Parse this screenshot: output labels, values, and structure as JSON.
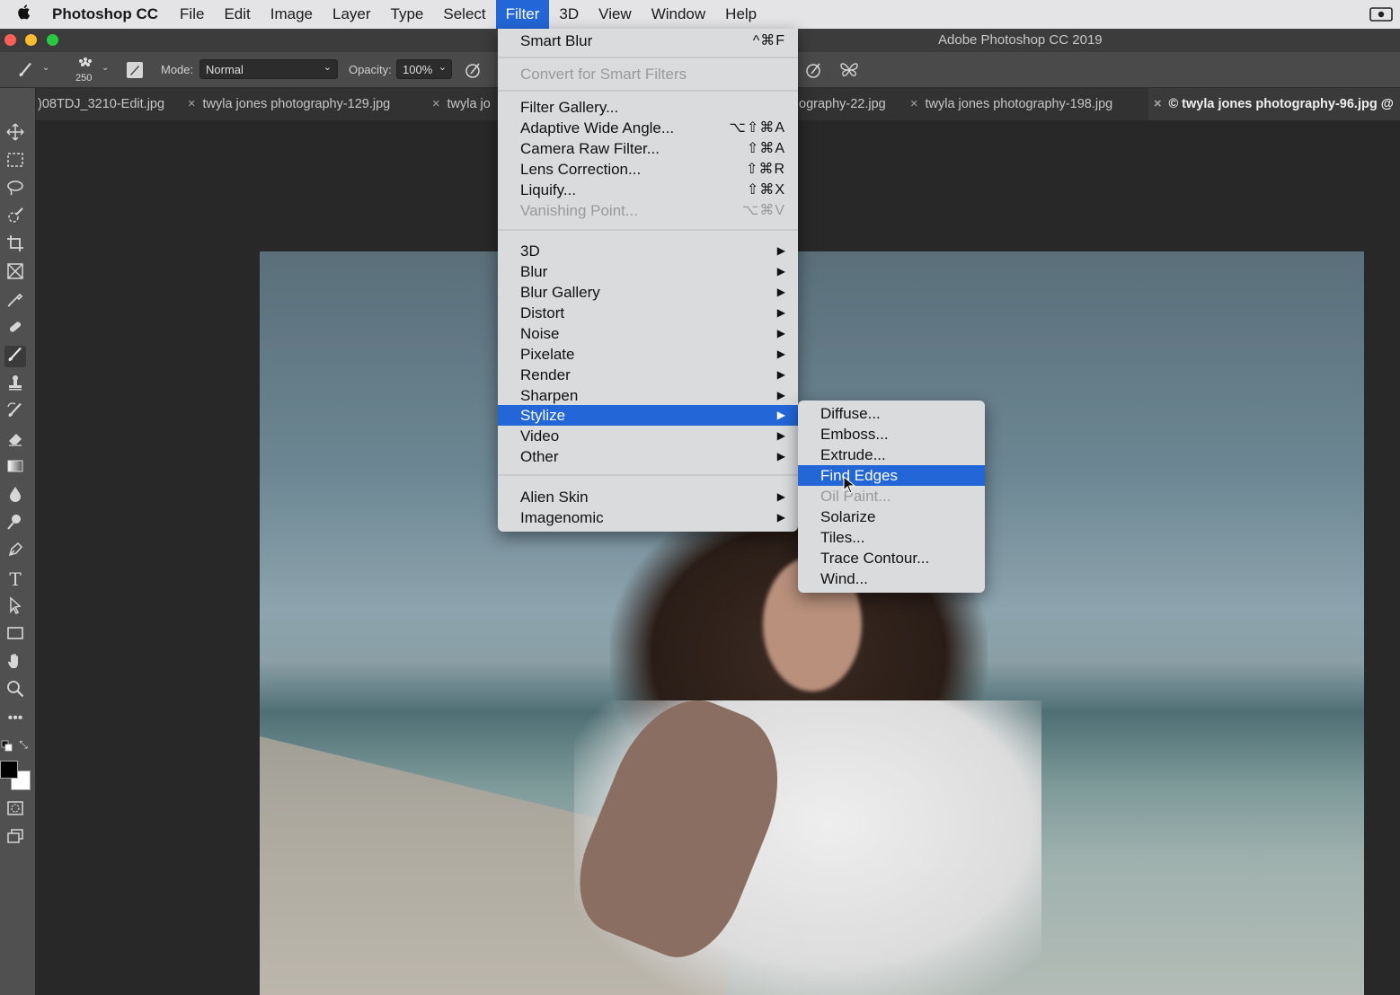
{
  "menubar": {
    "apple_icon": "apple-logo",
    "app_name": "Photoshop CC",
    "items": [
      "File",
      "Edit",
      "Image",
      "Layer",
      "Type",
      "Select",
      "Filter",
      "3D",
      "View",
      "Window",
      "Help"
    ],
    "active_item": "Filter"
  },
  "window": {
    "title": "Adobe Photoshop CC 2019",
    "traffic_lights": {
      "close": "#fe5f57",
      "minimize": "#febc2e",
      "zoom": "#28c840"
    }
  },
  "options_bar": {
    "brush_size": "250",
    "mode_label": "Mode:",
    "mode_value": "Normal",
    "opacity_label": "Opacity:",
    "opacity_value": "100%"
  },
  "tabs": [
    {
      "label": ")08TDJ_3210-Edit.jpg",
      "active": false
    },
    {
      "label": "twyla jones photography-129.jpg",
      "active": false
    },
    {
      "label": "twyla jo",
      "active": false
    },
    {
      "label": "ography-22.jpg",
      "active": false
    },
    {
      "label": "twyla jones photography-198.jpg",
      "active": false
    },
    {
      "label": "© twyla jones photography-96.jpg @",
      "active": true
    }
  ],
  "tab_close_glyph": "×",
  "filter_menu": {
    "items": [
      {
        "label": "Smart Blur",
        "shortcut": "^⌘F",
        "disabled": false
      },
      {
        "label": "Convert for Smart Filters",
        "shortcut": "",
        "disabled": true
      },
      {
        "label": "Filter Gallery...",
        "shortcut": "",
        "disabled": false
      },
      {
        "label": "Adaptive Wide Angle...",
        "shortcut": "⌥⇧⌘A",
        "disabled": false
      },
      {
        "label": "Camera Raw Filter...",
        "shortcut": "⇧⌘A",
        "disabled": false
      },
      {
        "label": "Lens Correction...",
        "shortcut": "⇧⌘R",
        "disabled": false
      },
      {
        "label": "Liquify...",
        "shortcut": "⇧⌘X",
        "disabled": false
      },
      {
        "label": "Vanishing Point...",
        "shortcut": "⌥⌘V",
        "disabled": true
      },
      {
        "label": "3D",
        "submenu": true
      },
      {
        "label": "Blur",
        "submenu": true
      },
      {
        "label": "Blur Gallery",
        "submenu": true
      },
      {
        "label": "Distort",
        "submenu": true
      },
      {
        "label": "Noise",
        "submenu": true
      },
      {
        "label": "Pixelate",
        "submenu": true
      },
      {
        "label": "Render",
        "submenu": true
      },
      {
        "label": "Sharpen",
        "submenu": true
      },
      {
        "label": "Stylize",
        "submenu": true,
        "highlighted": true
      },
      {
        "label": "Video",
        "submenu": true
      },
      {
        "label": "Other",
        "submenu": true
      },
      {
        "label": "Alien Skin",
        "submenu": true
      },
      {
        "label": "Imagenomic",
        "submenu": true
      }
    ],
    "submenu_arrow": "▶"
  },
  "stylize_menu": {
    "items": [
      {
        "label": "Diffuse...",
        "disabled": false
      },
      {
        "label": "Emboss...",
        "disabled": false
      },
      {
        "label": "Extrude...",
        "disabled": false
      },
      {
        "label": "Find Edges",
        "disabled": false,
        "highlighted": true
      },
      {
        "label": "Oil Paint...",
        "disabled": true
      },
      {
        "label": "Solarize",
        "disabled": false
      },
      {
        "label": "Tiles...",
        "disabled": false
      },
      {
        "label": "Trace Contour...",
        "disabled": false
      },
      {
        "label": "Wind...",
        "disabled": false
      }
    ]
  },
  "colors": {
    "highlight": "#2266d8",
    "menu_bg": "#dadbdd",
    "foreground_swatch": "#000000",
    "background_swatch": "#ffffff"
  }
}
